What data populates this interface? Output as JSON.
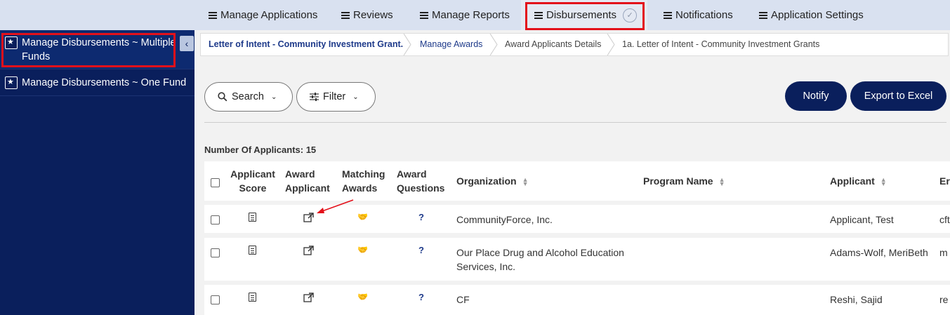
{
  "topnav": {
    "items": [
      {
        "label": "Manage Applications"
      },
      {
        "label": "Reviews"
      },
      {
        "label": "Manage Reports"
      },
      {
        "label": "Disbursements"
      },
      {
        "label": "Notifications"
      },
      {
        "label": "Application Settings"
      }
    ],
    "active": "Disbursements"
  },
  "sidebar": {
    "items": [
      {
        "label_line1": "Manage Disbursements ~ Multiple",
        "label_line2": "Funds"
      },
      {
        "label_line1": "Manage Disbursements ~ One Fund"
      }
    ]
  },
  "breadcrumb": [
    "Letter of Intent - Community Investment Grant.",
    "Manage Awards",
    "Award Applicants Details",
    "1a. Letter of Intent - Community Investment Grants"
  ],
  "toolbar": {
    "search_label": "Search",
    "filter_label": "Filter",
    "notify_label": "Notify",
    "export_label": "Export to Excel"
  },
  "count_text": "Number Of Applicants: 15",
  "table": {
    "headers": {
      "applicant_score_1": "Applicant",
      "applicant_score_2": "Score",
      "award_applicant_1": "Award",
      "award_applicant_2": "Applicant",
      "matching_awards_1": "Matching",
      "matching_awards_2": "Awards",
      "award_questions_1": "Award",
      "award_questions_2": "Questions",
      "organization": "Organization",
      "program_name": "Program Name",
      "applicant": "Applicant",
      "email_partial": "Er"
    },
    "rows": [
      {
        "organization_1": "CommunityForce, Inc.",
        "organization_2": "",
        "applicant": "Applicant, Test",
        "email_partial": "cft"
      },
      {
        "organization_1": "Our Place Drug and Alcohol Education",
        "organization_2": "Services, Inc.",
        "applicant": "Adams-Wolf, MeriBeth",
        "email_partial": "m"
      },
      {
        "organization_1": "CF",
        "organization_2": "",
        "applicant": "Reshi, Sajid",
        "email_partial": "re"
      }
    ]
  },
  "colors": {
    "navy": "#0a1f5c",
    "highlight_red": "#e3101a",
    "nav_bg": "#d9e1f0"
  }
}
